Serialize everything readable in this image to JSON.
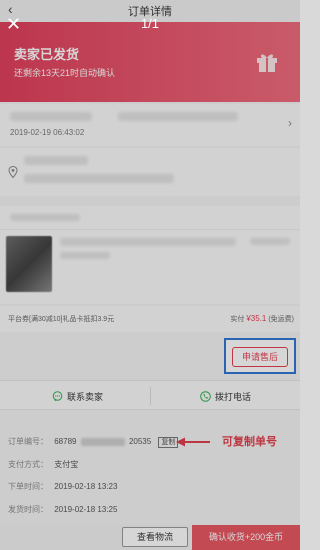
{
  "nav": {
    "back_icon": "‹",
    "title": "订单详情"
  },
  "viewer": {
    "close_icon": "✕",
    "counter": "1/1"
  },
  "status": {
    "title": "卖家已发货",
    "auto_confirm": "还剩余13天21时自动确认",
    "icon": "gift-icon"
  },
  "logistics": {
    "time": "2019-02-19 06:43:02"
  },
  "order": {
    "promo_text": "平台券[满30减10]礼品卡抵扣3.9元",
    "paid_label": "实付",
    "paid_amount": "¥35.1",
    "shipping": "(免运费)"
  },
  "after_sale": {
    "label": "申请售后"
  },
  "actions": {
    "contact_seller": "联系卖家",
    "call": "拨打电话"
  },
  "details": {
    "order_no_label": "订单编号：",
    "order_no_start": "68789",
    "order_no_end": "20535",
    "copy_label": "复制",
    "pay_label": "支付方式：",
    "pay_value": "支付宝",
    "order_time_label": "下单时间：",
    "order_time_value": "2019-02-18 13:23",
    "ship_time_label": "发货时间：",
    "ship_time_value": "2019-02-18 13:25"
  },
  "annotation": {
    "text": "可复制单号"
  },
  "bottom": {
    "view_logistics": "查看物流",
    "confirm": "确认收货+200金币"
  },
  "colors": {
    "brand": "#e03c58",
    "price": "#e83b4d",
    "highlight": "#2d73d2",
    "annotation": "#e03c4a"
  }
}
